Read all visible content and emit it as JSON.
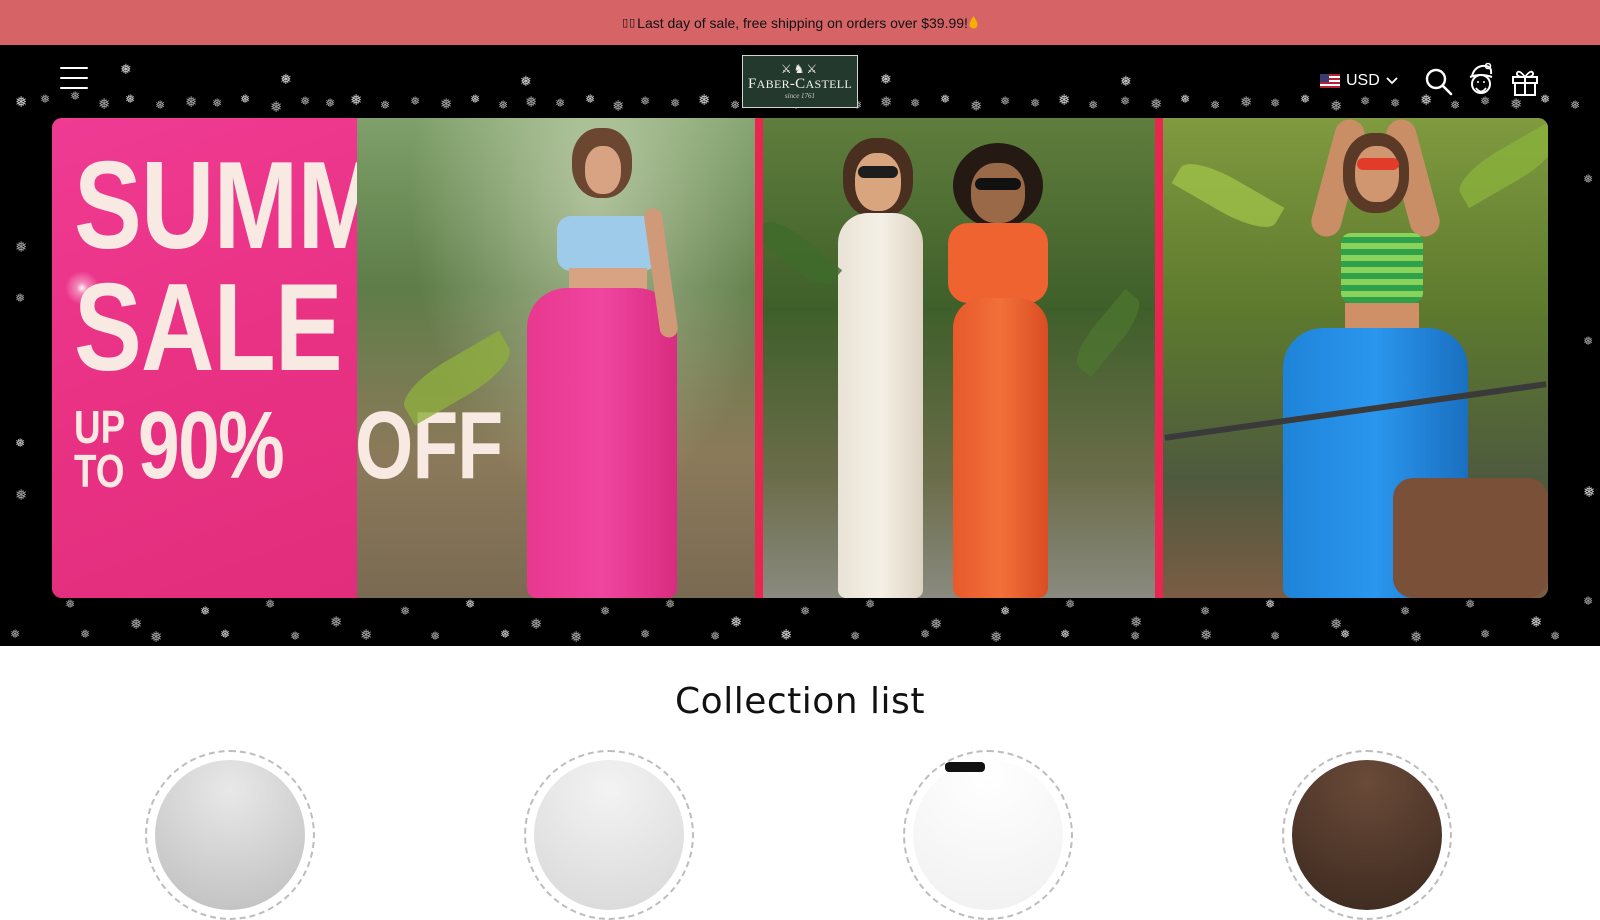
{
  "announcement": {
    "prefix": "▯▯",
    "text": "Last day of sale, free shipping on orders over $39.99!",
    "suffix_icon": "drop-emoji"
  },
  "header": {
    "menu_icon": "hamburger-icon",
    "logo": {
      "brand": "FABER-CASTELL",
      "since": "since 1761"
    },
    "currency": {
      "code": "USD",
      "flag": "us-flag-icon"
    },
    "icons": [
      "search-icon",
      "santa-face-icon",
      "gift-icon"
    ]
  },
  "hero": {
    "line1": "SUMMER",
    "line2": "SALE",
    "up": "UP",
    "to": "TO",
    "percent": "90%",
    "off": "OFF"
  },
  "collection": {
    "title": "Collection list",
    "items": [
      "",
      "",
      "",
      ""
    ]
  },
  "colors": {
    "announcement_bg": "#d66466",
    "header_bg": "#000000",
    "hero_pink": "#ec3a8b",
    "logo_green": "#24392e"
  }
}
